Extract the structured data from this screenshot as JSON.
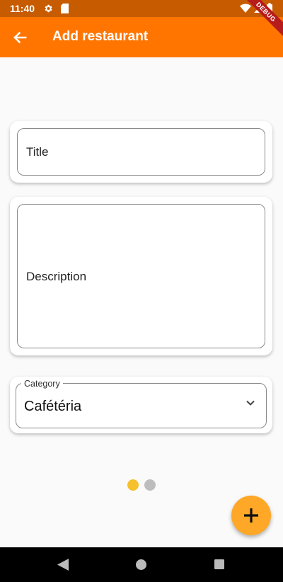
{
  "status_bar": {
    "time": "11:40",
    "debug_label": "DEBUG"
  },
  "app_bar": {
    "title": "Add restaurant"
  },
  "form": {
    "title_placeholder": "Title",
    "description_placeholder": "Description",
    "category_label": "Category",
    "category_value": "Cafétéria"
  },
  "pager": {
    "pages": 2,
    "active_index": 0
  },
  "colors": {
    "app_bar": "#FF7500",
    "status_bar": "#C75B00",
    "fab": "#FFA726",
    "dot_active": "#F6C12C",
    "dot_inactive": "#BDBDBD"
  },
  "icons": {
    "status": [
      "gear-icon",
      "sd-card-icon",
      "wifi-icon",
      "signal-icon",
      "battery-icon"
    ],
    "app_bar": "arrow-back-icon",
    "dropdown": "chevron-down-icon",
    "fab": "plus-icon",
    "nav": [
      "nav-back-icon",
      "nav-home-icon",
      "nav-recents-icon"
    ]
  }
}
